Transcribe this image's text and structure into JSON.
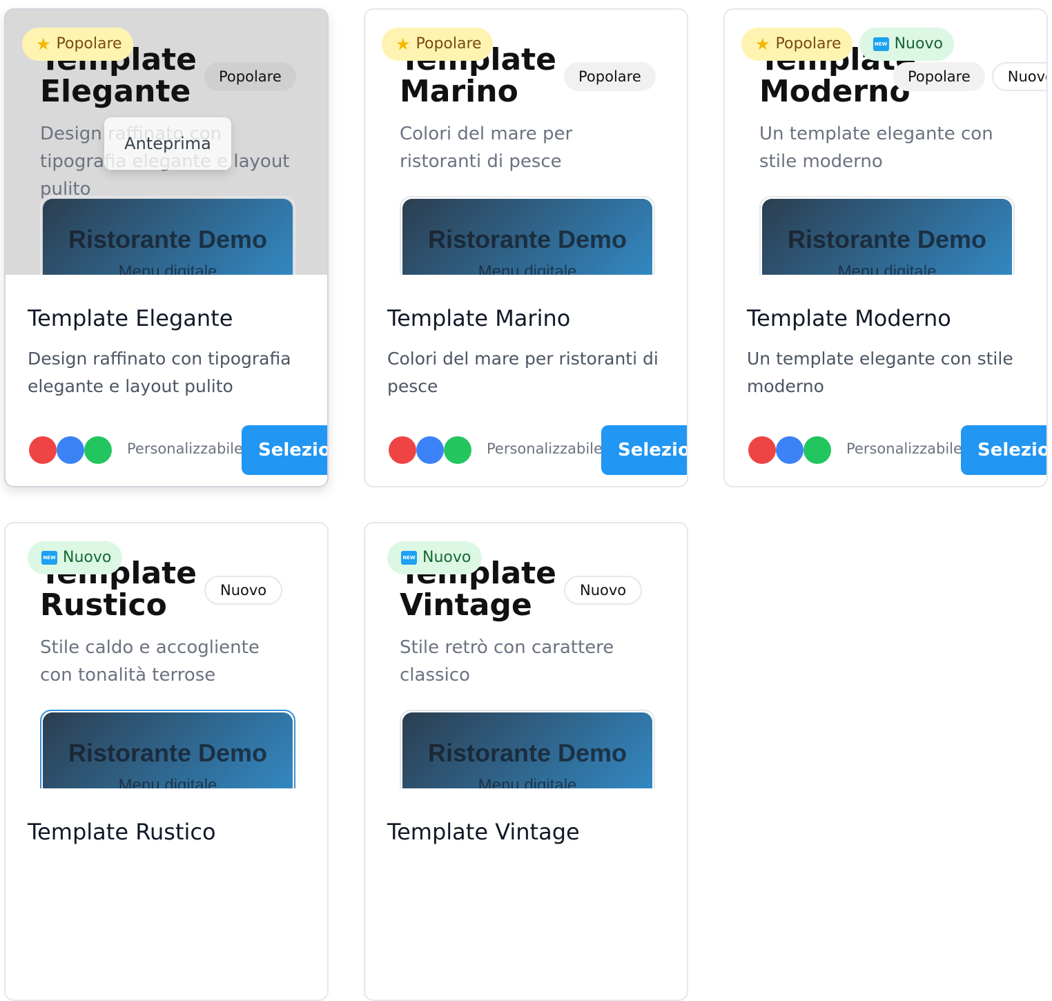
{
  "common": {
    "demo_title": "Ristorante Demo",
    "demo_subtitle": "Menu digitale",
    "customizable_label": "Personalizzabile",
    "select_label": "Selezion",
    "preview_label": "Anteprima",
    "badge_popular": "Popolare",
    "badge_new": "Nuovo"
  },
  "colors": {
    "red": "#ef4444",
    "blue": "#3b82f6",
    "green": "#22c55e",
    "accent": "#2196f3"
  },
  "cards": [
    {
      "preview_title": "Template Elegante",
      "pills": [
        "Popolare"
      ],
      "preview_desc": "Design raffinato con tipografia elegante e layout pulito",
      "title": "Template Elegante",
      "description": "Design raffinato con tipografia elegante e layout pulito",
      "badges": [
        "popular"
      ]
    },
    {
      "preview_title": "Template Marino",
      "pills": [
        "Popolare"
      ],
      "preview_desc": "Colori del mare per ristoranti di pesce",
      "title": "Template Marino",
      "description": "Colori del mare per ristoranti di pesce",
      "badges": [
        "popular"
      ]
    },
    {
      "preview_title": "Template Moderno",
      "pills": [
        "Popolare",
        "Nuovo"
      ],
      "preview_desc": "Un template elegante con stile moderno",
      "title": "Template Moderno",
      "description": "Un template elegante con stile moderno",
      "badges": [
        "popular",
        "new"
      ]
    },
    {
      "preview_title": "Template Rustico",
      "pills": [
        "Nuovo"
      ],
      "preview_desc": "Stile caldo e accogliente con tonalità terrose",
      "title": "Template Rustico",
      "badges": [
        "new"
      ]
    },
    {
      "preview_title": "Template Vintage",
      "pills": [
        "Nuovo"
      ],
      "preview_desc": "Stile retrò con carattere classico",
      "title": "Template Vintage",
      "badges": [
        "new"
      ]
    }
  ]
}
